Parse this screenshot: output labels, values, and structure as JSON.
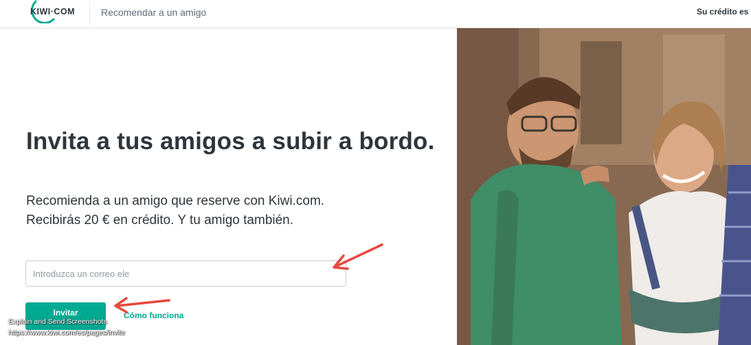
{
  "header": {
    "logo_text": "KIWI·COM",
    "title": "Recomendar a un amigo",
    "credit": "Su crédito es c"
  },
  "main": {
    "headline": "Invita a tus amigos a subir a bordo.",
    "subtext_line1": "Recomienda a un amigo que reserve con Kiwi.com.",
    "subtext_line2": "Recibirás 20 € en crédito. Y tu amigo también.",
    "email_placeholder": "Introduzca un correo ele",
    "invite_label": "Invitar",
    "how_link": "Cómo funciona"
  },
  "overlay": {
    "line1": "Explain and Send Screenshots",
    "line2": "https://www.kiwi.com/es/pages/invite"
  },
  "colors": {
    "brand": "#00a991",
    "text": "#2e353b",
    "arrow": "#e8473c"
  }
}
